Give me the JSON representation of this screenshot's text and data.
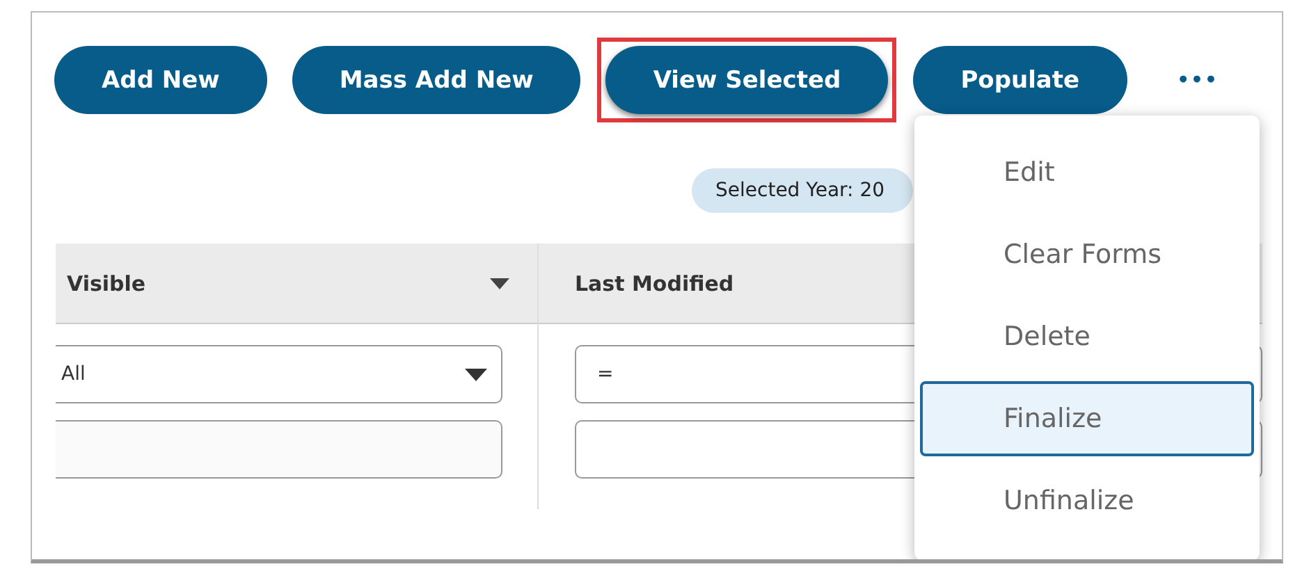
{
  "toolbar": {
    "buttons": [
      {
        "label": "Add New",
        "highlighted": false
      },
      {
        "label": "Mass Add New",
        "highlighted": false
      },
      {
        "label": "View Selected",
        "highlighted": true
      },
      {
        "label": "Populate",
        "highlighted": false
      }
    ],
    "more_label": "•••"
  },
  "badge": "Selected Year: 20",
  "table": {
    "columns": [
      {
        "title": "Visible",
        "kind": "select",
        "filter_value": "All"
      },
      {
        "title": "Last Modified",
        "kind": "input",
        "filter_value": "="
      }
    ]
  },
  "menu": {
    "items": [
      {
        "label": "Edit",
        "selected": false
      },
      {
        "label": "Clear Forms",
        "selected": false
      },
      {
        "label": "Delete",
        "selected": false
      },
      {
        "label": "Finalize",
        "selected": true
      },
      {
        "label": "Unfinalize",
        "selected": false
      }
    ]
  }
}
